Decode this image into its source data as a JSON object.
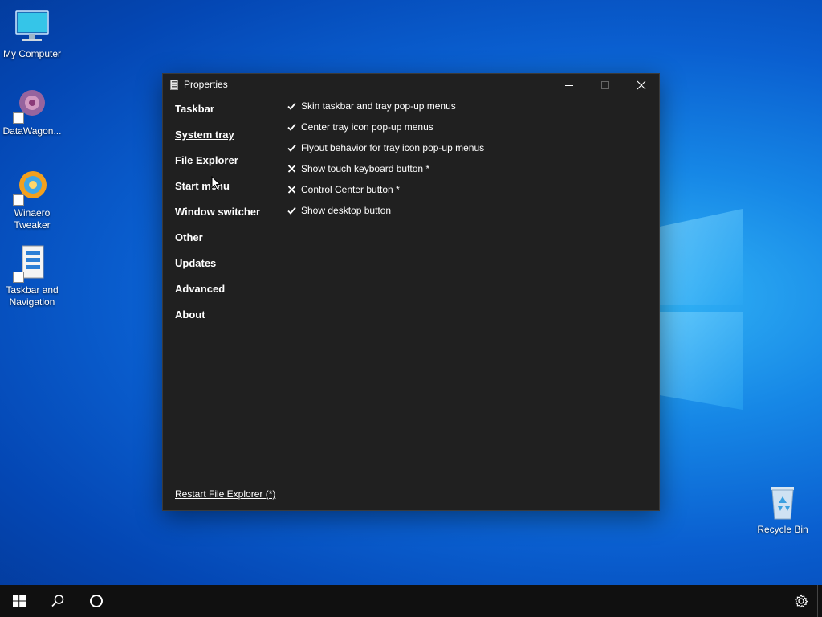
{
  "desktop": {
    "icons": [
      {
        "label": "My Computer"
      },
      {
        "label": "DataWagon..."
      },
      {
        "label": "Winaero Tweaker"
      },
      {
        "label": "Taskbar and Navigation"
      },
      {
        "label": "Recycle Bin"
      }
    ]
  },
  "window": {
    "title": "Properties",
    "nav": [
      {
        "label": "Taskbar"
      },
      {
        "label": "System tray"
      },
      {
        "label": "File Explorer"
      },
      {
        "label": "Start menu"
      },
      {
        "label": "Window switcher"
      },
      {
        "label": "Other"
      },
      {
        "label": "Updates"
      },
      {
        "label": "Advanced"
      },
      {
        "label": "About"
      }
    ],
    "options": [
      {
        "label": "Skin taskbar and tray pop-up menus",
        "state": "checked"
      },
      {
        "label": "Center tray icon pop-up menus",
        "state": "checked"
      },
      {
        "label": "Flyout behavior for tray icon pop-up menus",
        "state": "checked"
      },
      {
        "label": "Show touch keyboard button *",
        "state": "unchecked"
      },
      {
        "label": "Control Center button *",
        "state": "unchecked"
      },
      {
        "label": "Show desktop button",
        "state": "checked"
      }
    ],
    "restart_link": "Restart File Explorer (*)"
  },
  "colors": {
    "window_bg": "#202020",
    "taskbar_bg": "#101010",
    "text": "#ffffff"
  }
}
